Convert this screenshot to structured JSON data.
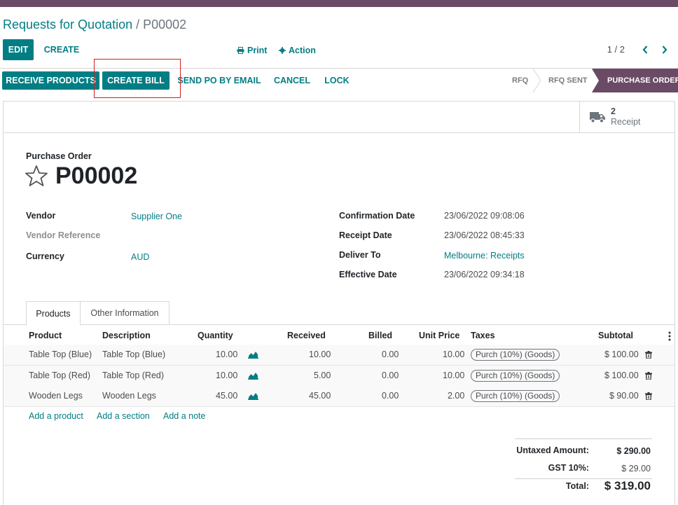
{
  "breadcrumb": {
    "parent": "Requests for Quotation",
    "separator": " / ",
    "current": "P00002"
  },
  "toolbar": {
    "edit": "EDIT",
    "create": "CREATE",
    "print": "Print",
    "action": "Action"
  },
  "pager": {
    "value": "1 / 2"
  },
  "status_buttons": {
    "receive_products": "RECEIVE PRODUCTS",
    "create_bill": "CREATE BILL",
    "send_po_by_email": "SEND PO BY EMAIL",
    "cancel": "CANCEL",
    "lock": "LOCK"
  },
  "stages": {
    "rfq": "RFQ",
    "rfq_sent": "RFQ SENT",
    "purchase_order": "PURCHASE ORDER"
  },
  "smart_button": {
    "count": "2",
    "label": "Receipt"
  },
  "form": {
    "doc_label": "Purchase Order",
    "doc_name": "P00002",
    "vendor_label": "Vendor",
    "vendor_value": "Supplier One",
    "vendor_ref_label": "Vendor Reference",
    "currency_label": "Currency",
    "currency_value": "AUD",
    "confirmation_label": "Confirmation Date",
    "confirmation_value": "23/06/2022 09:08:06",
    "receipt_label": "Receipt Date",
    "receipt_value": "23/06/2022 08:45:33",
    "deliver_label": "Deliver To",
    "deliver_value": "Melbourne: Receipts",
    "effective_label": "Effective Date",
    "effective_value": "23/06/2022 09:34:18"
  },
  "tabs": {
    "products": "Products",
    "other_info": "Other Information"
  },
  "table": {
    "headers": {
      "product": "Product",
      "description": "Description",
      "quantity": "Quantity",
      "received": "Received",
      "billed": "Billed",
      "unit_price": "Unit Price",
      "taxes": "Taxes",
      "subtotal": "Subtotal"
    },
    "rows": [
      {
        "product": "Table Top (Blue)",
        "description": "Table Top (Blue)",
        "quantity": "10.00",
        "received": "10.00",
        "billed": "0.00",
        "unit_price": "10.00",
        "taxes": "Purch (10%) (Goods)",
        "subtotal": "$ 100.00"
      },
      {
        "product": "Table Top (Red)",
        "description": "Table Top (Red)",
        "quantity": "10.00",
        "received": "5.00",
        "billed": "0.00",
        "unit_price": "10.00",
        "taxes": "Purch (10%) (Goods)",
        "subtotal": "$ 100.00"
      },
      {
        "product": "Wooden Legs",
        "description": "Wooden Legs",
        "quantity": "45.00",
        "received": "45.00",
        "billed": "0.00",
        "unit_price": "2.00",
        "taxes": "Purch (10%) (Goods)",
        "subtotal": "$ 90.00"
      }
    ],
    "add_product": "Add a product",
    "add_section": "Add a section",
    "add_note": "Add a note"
  },
  "totals": {
    "untaxed_label": "Untaxed Amount:",
    "untaxed_value": "$ 290.00",
    "gst_label": "GST 10%:",
    "gst_value": "$ 29.00",
    "total_label": "Total:",
    "total_value": "$ 319.00"
  },
  "colors": {
    "primary": "#017e84",
    "brand": "#6b4a66",
    "highlight": "#d11f1f"
  },
  "icons": [
    "print-icon",
    "gear-icon",
    "chevron-left-icon",
    "chevron-right-icon",
    "truck-icon",
    "star-icon",
    "area-chart-icon",
    "trash-icon",
    "kebab-menu-icon"
  ]
}
